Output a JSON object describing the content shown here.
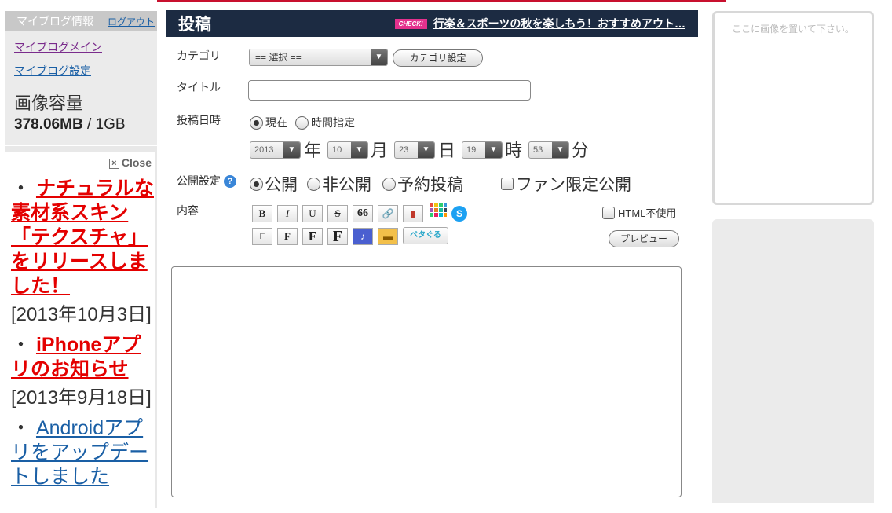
{
  "sidebar": {
    "header": "マイブログ情報",
    "logout": "ログアウト",
    "links": [
      "マイブログメイン",
      "マイブログ設定"
    ],
    "capacity_label": "画像容量",
    "capacity_used": "378.06MB",
    "capacity_total": " / 1GB",
    "close": "Close",
    "news": [
      {
        "bullet": "・",
        "title": "ナチュラルな素材系スキン「テクスチャ」をリリースしました！",
        "date": "[2013年10月3日]",
        "style": "red"
      },
      {
        "bullet": "・",
        "title": "iPhoneアプリのお知らせ",
        "date": "[2013年9月18日]",
        "style": "red"
      },
      {
        "bullet": "・",
        "title": "Androidアプリをアップデートしました",
        "date": "",
        "style": "blue"
      }
    ]
  },
  "main": {
    "title": "投稿",
    "check_badge": "CHECK!",
    "check_text": "行楽＆スポーツの秋を楽しもう！おすすめアウト…",
    "category_label": "カテゴリ",
    "category_value": "== 選択 ==",
    "category_settings": "カテゴリ設定",
    "title_label": "タイトル",
    "date_label": "投稿日時",
    "radio_now": "現在",
    "radio_specify": "時間指定",
    "year": "2013",
    "year_unit": "年",
    "month": "10",
    "month_unit": "月",
    "day": "23",
    "day_unit": "日",
    "hour": "19",
    "hour_unit": "時",
    "minute": "53",
    "minute_unit": "分",
    "public_label": "公開設定",
    "public": "公開",
    "private": "非公開",
    "scheduled": "予約投稿",
    "fan_only": "ファン限定公開",
    "content_label": "内容",
    "html_off": "HTML不使用",
    "preview": "プレビュー",
    "toolbar_row1": [
      "B",
      "I",
      "U",
      "S",
      "66"
    ],
    "toolbar_row2": [
      "F",
      "F",
      "F",
      "F"
    ],
    "petagoru": "ペタぐる"
  },
  "right": {
    "drop_text": "ここに画像を置いて下さい。"
  }
}
